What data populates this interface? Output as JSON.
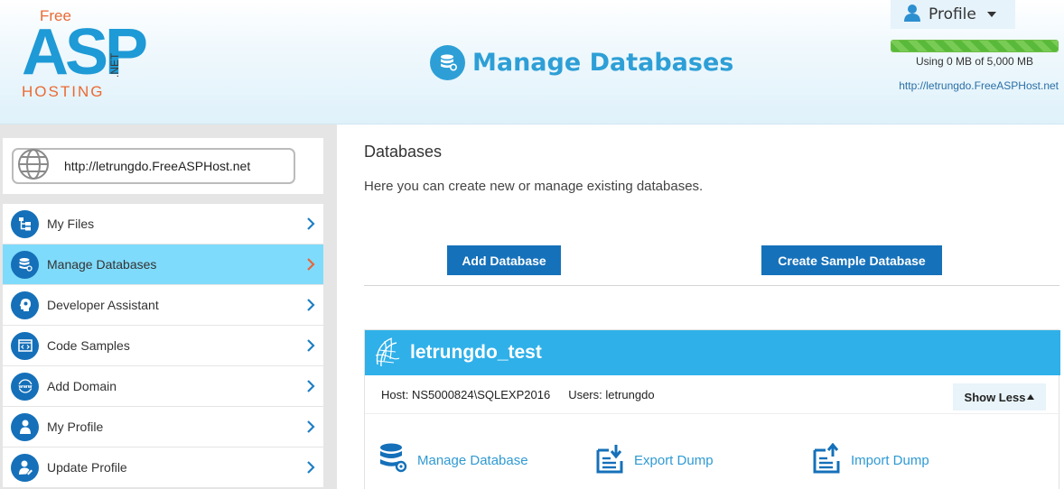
{
  "header": {
    "logo": {
      "free": "Free",
      "asp": "ASP",
      "hosting": "HOSTING",
      "net": ".NET"
    },
    "title": "Manage Databases",
    "profile_label": "Profile",
    "usage_text": "Using 0 MB of 5,000 MB",
    "usage_fraction": 0.0,
    "site_url": "http://letrungdo.FreeASPHost.net"
  },
  "sidebar": {
    "site_url": "http://letrungdo.FreeASPHost.net",
    "items": [
      {
        "label": "My Files",
        "icon": "files-icon",
        "active": false
      },
      {
        "label": "Manage Databases",
        "icon": "database-icon",
        "active": true
      },
      {
        "label": "Developer Assistant",
        "icon": "developer-head-icon",
        "active": false
      },
      {
        "label": "Code Samples",
        "icon": "code-icon",
        "active": false
      },
      {
        "label": "Add Domain",
        "icon": "www-icon",
        "active": false
      },
      {
        "label": "My Profile",
        "icon": "user-icon",
        "active": false
      },
      {
        "label": "Update Profile",
        "icon": "user-edit-icon",
        "active": false
      }
    ]
  },
  "main": {
    "heading": "Databases",
    "description": "Here you can create new or manage existing databases.",
    "add_button": "Add Database",
    "sample_button": "Create Sample Database",
    "database": {
      "name": "letrungdo_test",
      "host": "Host: NS5000824\\SQLEXP2016",
      "users": "Users: letrungdo",
      "show_less": "Show Less",
      "actions": {
        "manage": "Manage Database",
        "export": "Export Dump",
        "import": "Import Dump"
      }
    }
  },
  "colors": {
    "accent": "#2e9fd6",
    "nav_icon": "#1570b9",
    "active_nav": "#7fdbfb",
    "button": "#1571ba",
    "db_header": "#2fb0e9",
    "active_chevron": "#e8663a"
  }
}
